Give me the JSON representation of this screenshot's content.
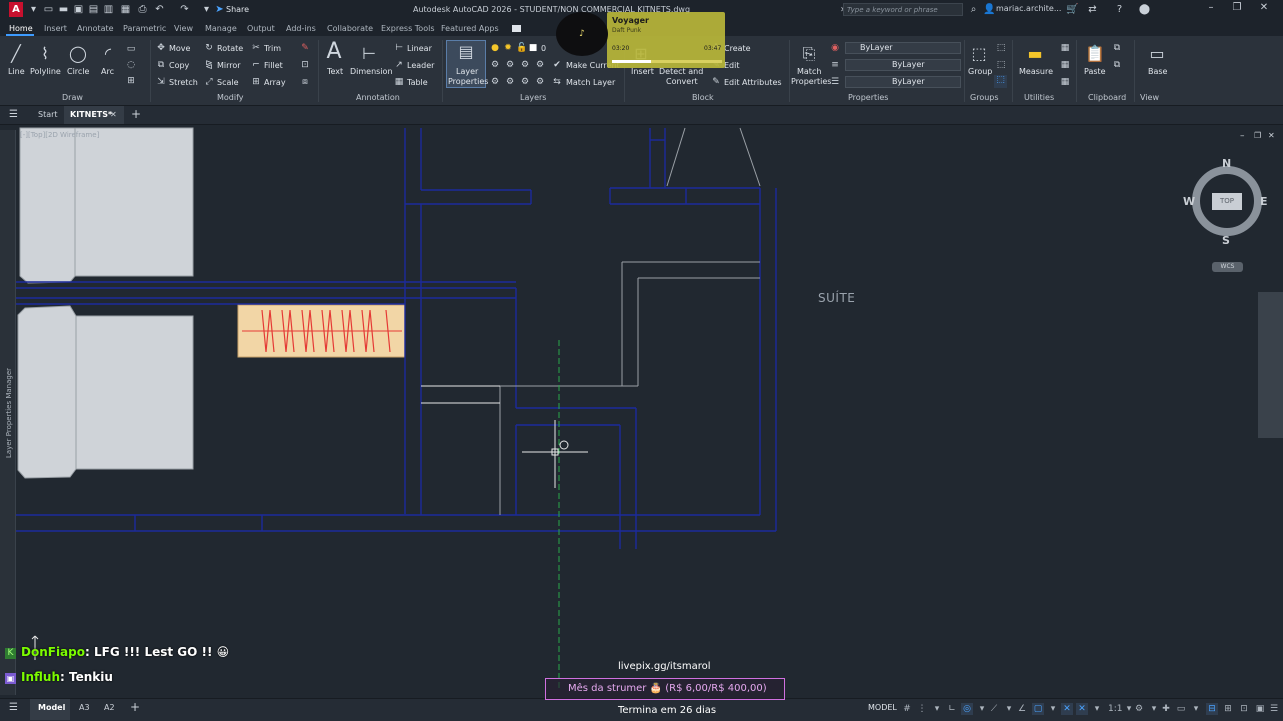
{
  "title_bar": {
    "title": "Autodesk AutoCAD 2026 - STUDENT/NON COMMERCIAL   KITNETS.dwg",
    "share_label": "Share",
    "search_placeholder": "Type a keyword or phrase",
    "user": "mariac.archite..."
  },
  "ribbon_tabs": [
    "Home",
    "Insert",
    "Annotate",
    "Parametric",
    "View",
    "Manage",
    "Output",
    "Add-ins",
    "Collaborate",
    "Express Tools",
    "Featured Apps"
  ],
  "ribbon": {
    "draw": {
      "line": "Line",
      "polyline": "Polyline",
      "circle": "Circle",
      "arc": "Arc",
      "panel": "Draw"
    },
    "modify": {
      "move": "Move",
      "rotate": "Rotate",
      "trim": "Trim",
      "copy": "Copy",
      "mirror": "Mirror",
      "fillet": "Fillet",
      "stretch": "Stretch",
      "scale": "Scale",
      "array": "Array",
      "panel": "Modify"
    },
    "annotation": {
      "text": "Text",
      "dimension": "Dimension",
      "linear": "Linear",
      "leader": "Leader",
      "table": "Table",
      "panel": "Annotation"
    },
    "layers": {
      "layer_properties_1": "Layer",
      "layer_properties_2": "Properties",
      "layer_value": "0",
      "make_current": "Make Current",
      "match_layer": "Match Layer",
      "panel": "Layers"
    },
    "block": {
      "insert": "Insert",
      "create": "Create",
      "edit": "Edit",
      "edit_attributes": "Edit Attributes",
      "detect_1": "Detect and",
      "detect_2": "Convert",
      "panel": "Block"
    },
    "properties": {
      "match_1": "Match",
      "match_2": "Properties",
      "color": "ByLayer",
      "linetype": "ByLayer",
      "lineweight": "ByLayer",
      "panel": "Properties"
    },
    "groups": {
      "group": "Group",
      "panel": "Groups"
    },
    "utilities": {
      "measure": "Measure",
      "panel": "Utilities"
    },
    "clipboard": {
      "paste": "Paste",
      "panel": "Clipboard"
    },
    "view": {
      "base": "Base",
      "panel": "View"
    }
  },
  "doc_tabs": {
    "start": "Start",
    "active": "KITNETS*"
  },
  "viewport": {
    "view_label": "[-][Top][2D Wireframe]",
    "room_label": "SUÍTE",
    "side_panel": "Layer Properties Manager",
    "viewcube": {
      "face": "TOP",
      "north": "N",
      "south": "S",
      "east": "E",
      "west": "W",
      "wcs": "WCS"
    }
  },
  "music_overlay": {
    "title": "Voyager",
    "artist": "Daft Punk",
    "elapsed": "03:20",
    "total": "03:47",
    "progress": 0.35
  },
  "chat": [
    {
      "user": "DonFiapo",
      "message": ": LFG !!! Lest GO !! 😀"
    },
    {
      "user": "Influh",
      "message": ": Tenkiu"
    }
  ],
  "donation": {
    "link": "livepix.gg/itsmarol",
    "goal": "Mês da strumer 🎂 (R$ 6,00/R$ 400,00)",
    "ends": "Termina em 26 dias"
  },
  "status_bar": {
    "layout_tabs": [
      "Model",
      "A3",
      "A2"
    ],
    "mode": "MODEL",
    "scale": "1:1"
  },
  "colors": {
    "wall_lines": "#1c2a9c",
    "furniture": "#d2d6db",
    "wardrobe_fill": "#f2d6a6",
    "wardrobe_lines": "#e53935",
    "cursor": "#e8e8e8",
    "accent": "#3d9bff"
  }
}
